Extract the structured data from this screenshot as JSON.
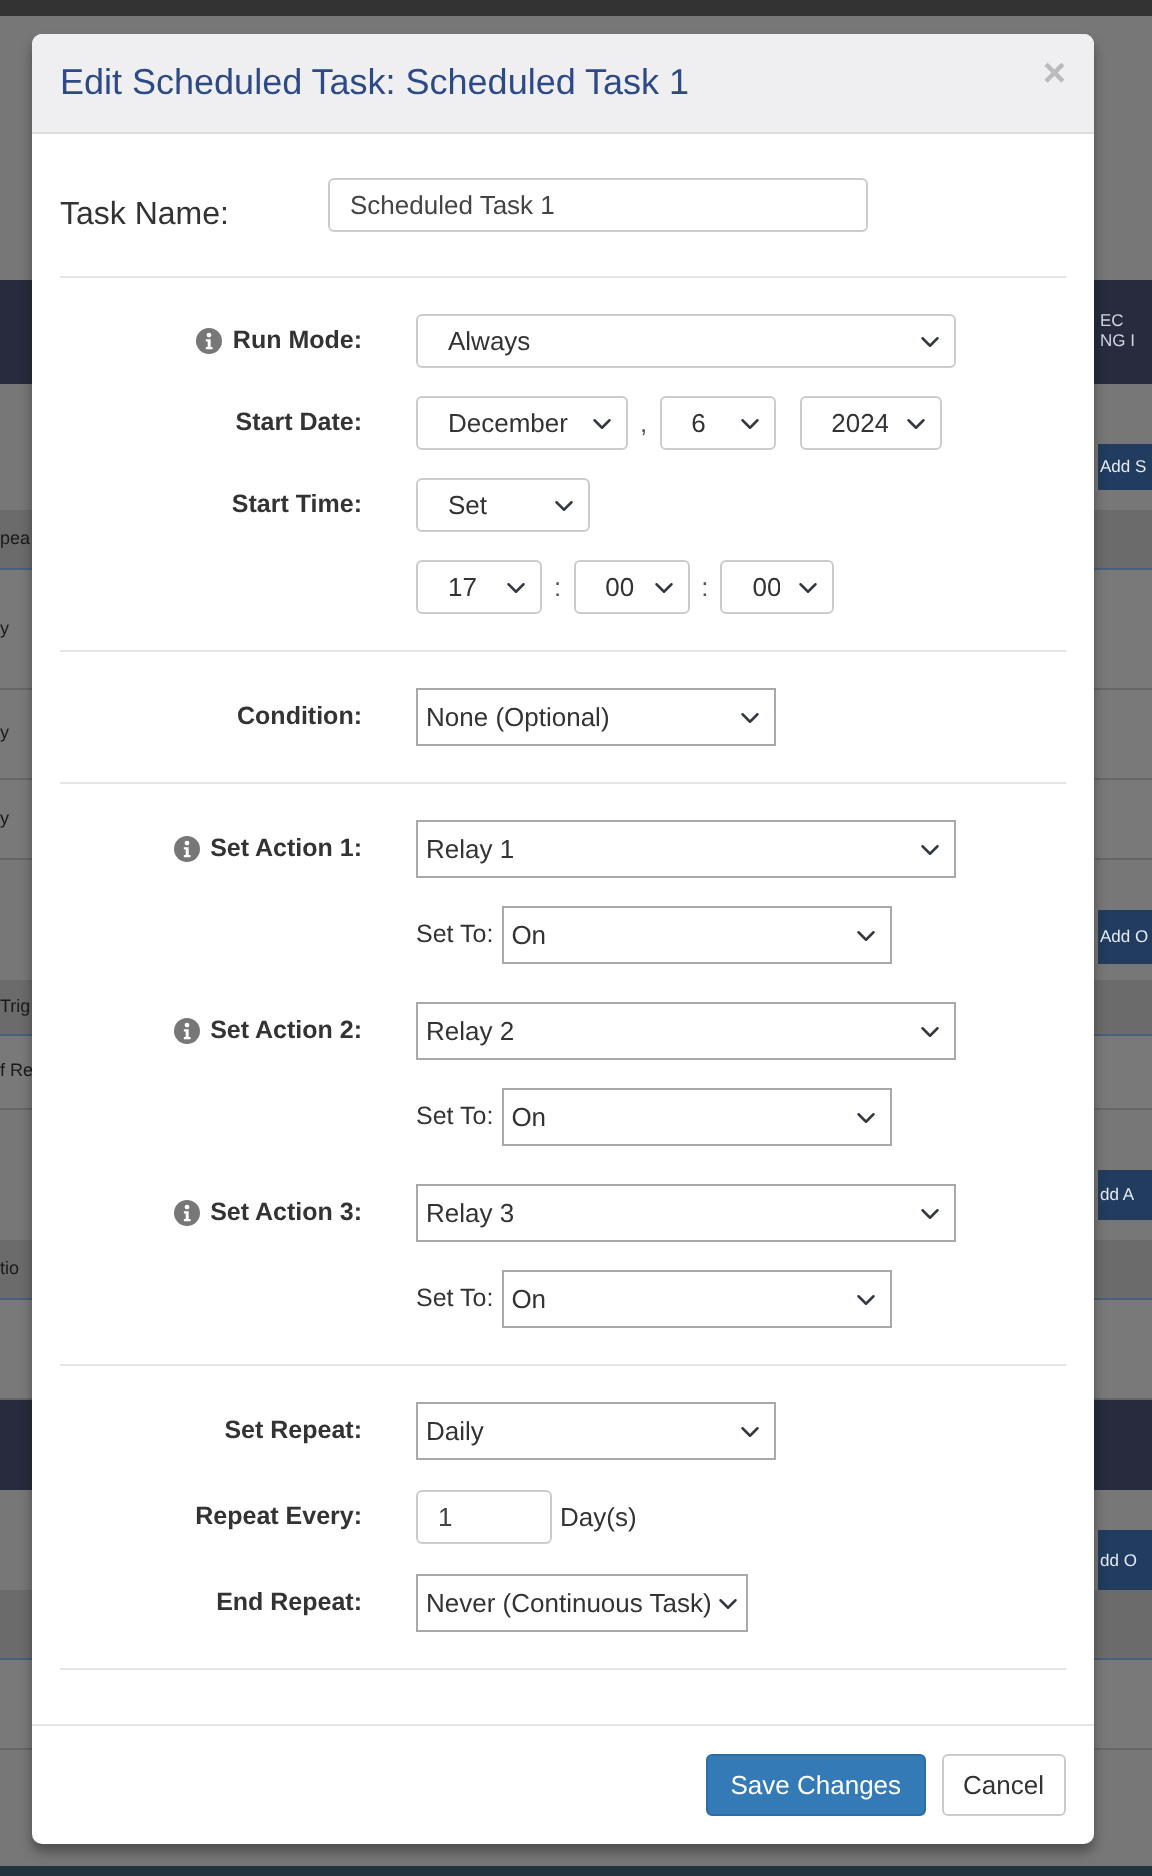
{
  "background": [
    {
      "kind": "topbar"
    },
    {
      "kind": "blank"
    },
    {
      "kind": "banner",
      "right_lines": [
        "EC",
        "NG I"
      ]
    },
    {
      "kind": "blank"
    },
    {
      "kind": "button",
      "right": "Add S"
    },
    {
      "kind": "blank"
    },
    {
      "kind": "head",
      "left": "pea"
    },
    {
      "kind": "row",
      "left": "y"
    },
    {
      "kind": "row",
      "left": "y"
    },
    {
      "kind": "row",
      "left": "y"
    },
    {
      "kind": "blank"
    },
    {
      "kind": "button",
      "right": "Add O"
    },
    {
      "kind": "blank"
    },
    {
      "kind": "head",
      "left": "Trig"
    },
    {
      "kind": "row",
      "left": "f Re"
    },
    {
      "kind": "blank"
    },
    {
      "kind": "button",
      "right": "dd A"
    },
    {
      "kind": "blank"
    },
    {
      "kind": "head",
      "left": "tio"
    },
    {
      "kind": "row"
    },
    {
      "kind": "banner"
    },
    {
      "kind": "blank"
    },
    {
      "kind": "button",
      "right": "dd O"
    },
    {
      "kind": "head"
    },
    {
      "kind": "row"
    },
    {
      "kind": "footer"
    }
  ],
  "dialog": {
    "title": "Edit Scheduled Task: Scheduled Task 1",
    "close": "×",
    "task_name": {
      "label": "Task Name:",
      "value": "Scheduled Task 1"
    },
    "sections": [
      {
        "fields": [
          {
            "kind": "select",
            "label": "Run Mode:",
            "info": true,
            "value": "Always"
          },
          {
            "kind": "date",
            "label": "Start Date:",
            "parts": [
              "December",
              "6",
              "2024"
            ],
            "separators": [
              ","
            ]
          },
          {
            "kind": "select",
            "label": "Start Time:",
            "info": false,
            "value": "Set"
          },
          {
            "kind": "time",
            "parts": [
              "17",
              "00",
              "00"
            ],
            "separators": [
              ":",
              ":"
            ]
          }
        ]
      },
      {
        "fields": [
          {
            "kind": "select",
            "label": "Condition:",
            "info": false,
            "value": "None (Optional)"
          }
        ]
      },
      {
        "fields": [
          {
            "kind": "action",
            "label": "Set Action 1:",
            "info": true,
            "value": "Relay 1",
            "set_to_label": "Set To:",
            "set_to": "On"
          },
          {
            "kind": "action",
            "label": "Set Action 2:",
            "info": true,
            "value": "Relay 2",
            "set_to_label": "Set To:",
            "set_to": "On"
          },
          {
            "kind": "action",
            "label": "Set Action 3:",
            "info": true,
            "value": "Relay 3",
            "set_to_label": "Set To:",
            "set_to": "On"
          }
        ]
      },
      {
        "fields": [
          {
            "kind": "select",
            "label": "Set Repeat:",
            "info": false,
            "value": "Daily"
          },
          {
            "kind": "number",
            "label": "Repeat Every:",
            "value": "1",
            "unit": "Day(s)"
          },
          {
            "kind": "select",
            "label": "End Repeat:",
            "info": false,
            "value": "Never (Continuous Task)"
          }
        ]
      }
    ],
    "buttons": [
      {
        "label": "Save Changes",
        "kind": "primary"
      },
      {
        "label": "Cancel",
        "kind": "default"
      }
    ]
  }
}
